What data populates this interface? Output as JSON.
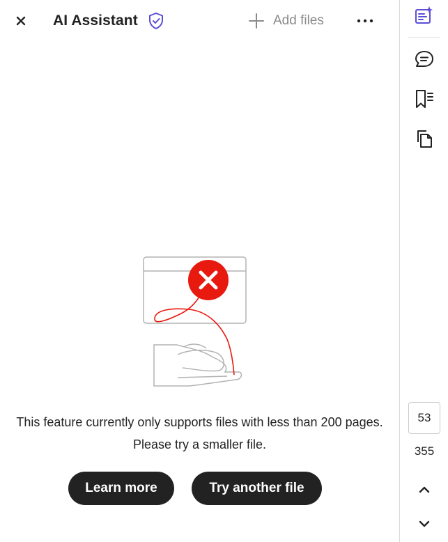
{
  "header": {
    "title": "AI Assistant",
    "add_files_label": "Add files",
    "icons": {
      "close": "close-icon",
      "shield": "shield-check-icon",
      "add": "plus-icon",
      "more": "more-horizontal-icon"
    },
    "accent_color": "#5b4ed6"
  },
  "main": {
    "message_line1": "This feature currently only supports files with less than 200 pages.",
    "message_line2": "Please try a smaller file.",
    "learn_more_label": "Learn more",
    "try_another_label": "Try another file",
    "illustration": "file-upload-error-illustration",
    "error_color": "#e8190e"
  },
  "rail": {
    "icons": [
      "ai-assistant-icon",
      "comment-icon",
      "bookmark-icon",
      "copy-pages-icon",
      "chevron-up-icon",
      "chevron-down-icon"
    ],
    "current_page": "53",
    "total_pages": "355"
  }
}
